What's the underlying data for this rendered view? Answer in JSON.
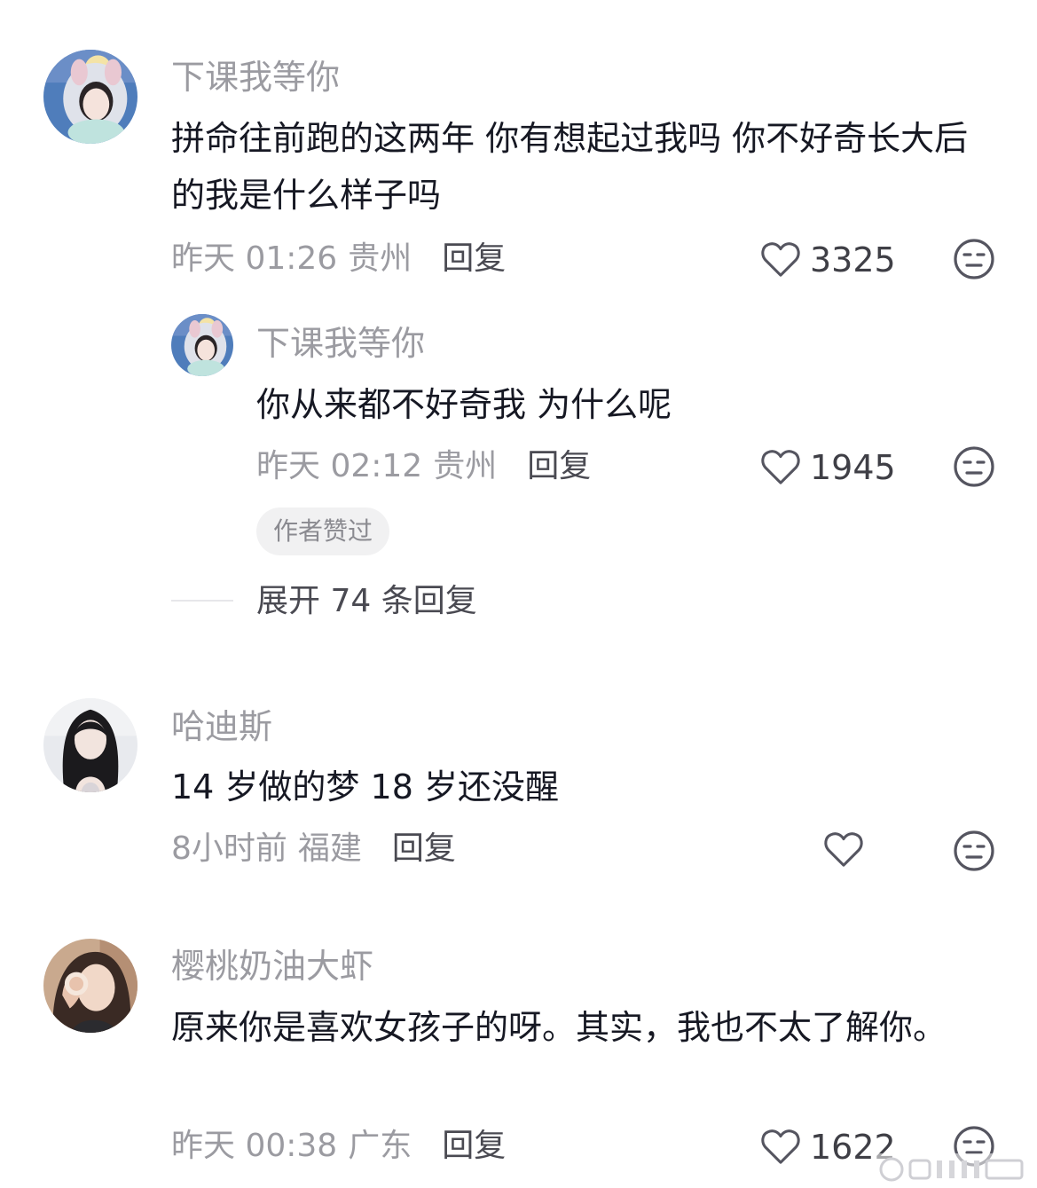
{
  "comments": [
    {
      "username": "下课我等你",
      "text": "拼命往前跑的这两年 你有想起过我吗 你不好奇长大后的我是什么样子吗",
      "time": "昨天 01:26",
      "location": "贵州",
      "reply_label": "回复",
      "likes": "3325",
      "avatar_icon": "girl-hood-avatar",
      "replies": [
        {
          "username": "下课我等你",
          "text": "你从来都不好奇我 为什么呢",
          "time": "昨天 02:12",
          "location": "贵州",
          "reply_label": "回复",
          "likes": "1945",
          "badge": "作者赞过",
          "avatar_icon": "girl-hood-avatar"
        }
      ],
      "expand_label": "展开 74 条回复"
    },
    {
      "username": "哈迪斯",
      "text": "14 岁做的梦 18 岁还没醒",
      "time": "8小时前",
      "location": "福建",
      "reply_label": "回复",
      "likes": "",
      "avatar_icon": "long-hair-girl-avatar"
    },
    {
      "username": "樱桃奶油大虾",
      "text": "原来你是喜欢女孩子的呀。其实，我也不太了解你。",
      "time": "昨天 00:38",
      "location": "广东",
      "reply_label": "回复",
      "likes": "1622",
      "avatar_icon": "selfie-girl-avatar"
    }
  ],
  "icons": {
    "like": "heart-outline-icon",
    "dislike": "neutral-face-icon"
  },
  "colors": {
    "primary_text": "#161823",
    "secondary_text": "#9b9ba1",
    "badge_bg": "#f1f1f2"
  }
}
